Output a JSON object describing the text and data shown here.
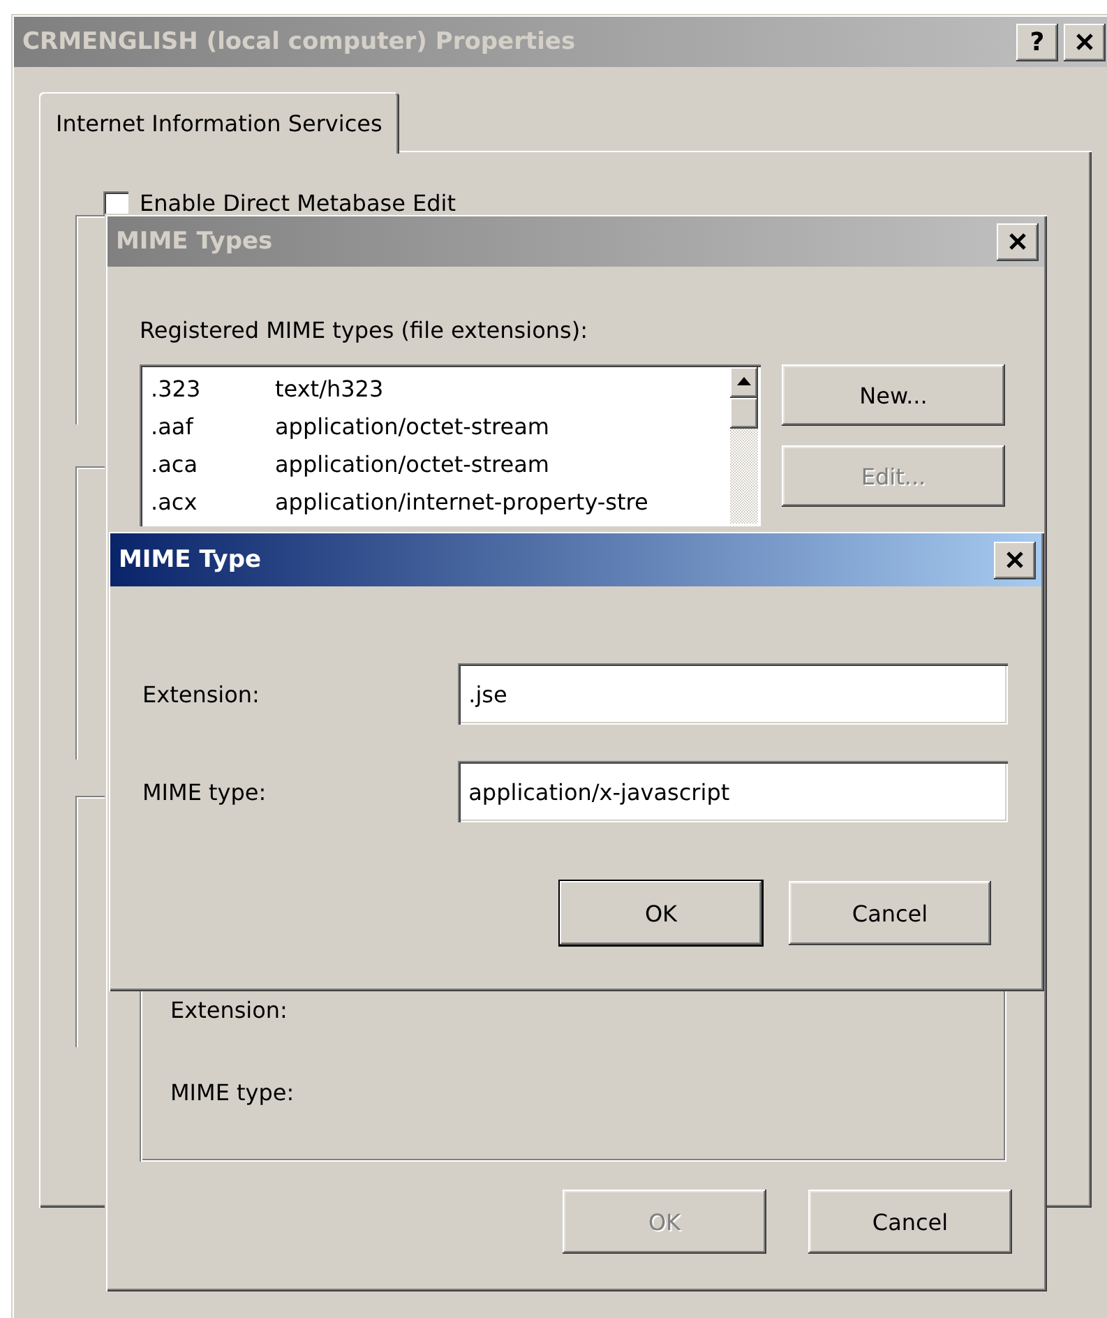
{
  "properties_window": {
    "title": "CRMENGLISH (local computer) Properties",
    "active": false,
    "help_button": "?",
    "tabs": [
      {
        "label": "Internet Information Services",
        "selected": true
      }
    ],
    "checkbox": {
      "label": "Enable Direct Metabase Edit",
      "checked": false
    }
  },
  "mime_types_window": {
    "title": "MIME Types",
    "active": false,
    "list_label": "Registered MIME types (file extensions):",
    "rows": [
      {
        "extension": ".323",
        "type": "text/h323",
        "selected": false
      },
      {
        "extension": ".aaf",
        "type": "application/octet-stream",
        "selected": false
      },
      {
        "extension": ".aca",
        "type": "application/octet-stream",
        "selected": false
      },
      {
        "extension": ".acx",
        "type": "application/internet-property-stre",
        "selected": false
      }
    ],
    "side_buttons": [
      {
        "label": "New...",
        "disabled": false
      },
      {
        "label": "Edit...",
        "disabled": true
      }
    ],
    "details": {
      "extension_label": "Extension:",
      "mime_type_label": "MIME type:"
    },
    "footer_buttons": [
      {
        "label": "OK",
        "disabled": true
      },
      {
        "label": "Cancel",
        "disabled": false
      }
    ]
  },
  "mime_type_dialog": {
    "title": "MIME Type",
    "active": true,
    "fields": [
      {
        "label": "Extension:",
        "value": ".jse"
      },
      {
        "label": "MIME type:",
        "value": "application/x-javascript"
      }
    ],
    "buttons": [
      {
        "label": "OK",
        "default": true
      },
      {
        "label": "Cancel",
        "default": false
      }
    ]
  }
}
